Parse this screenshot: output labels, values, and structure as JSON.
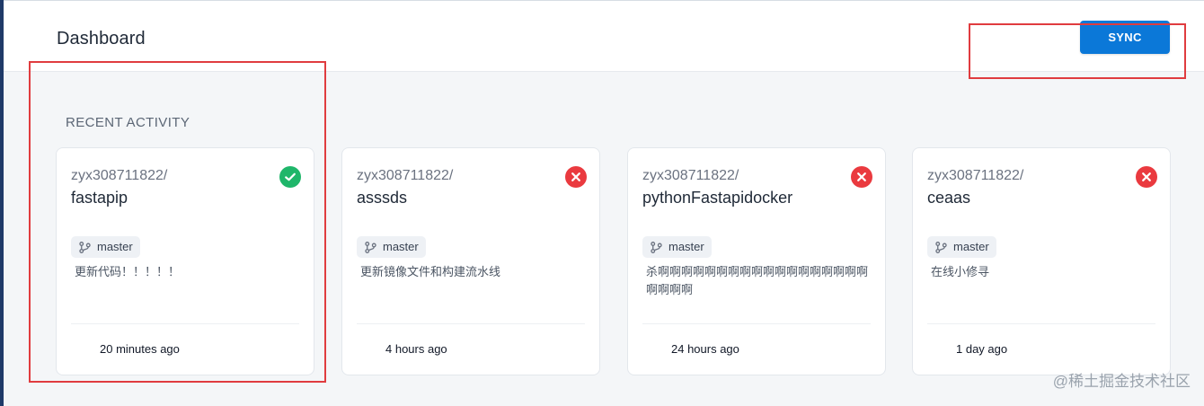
{
  "header": {
    "title": "Dashboard",
    "sync_label": "SYNC"
  },
  "section": {
    "title": "RECENT ACTIVITY"
  },
  "cards": [
    {
      "owner": "zyx308711822/",
      "repo": "fastapip",
      "status": "success",
      "status_icon": "check-circle-icon",
      "branch": "master",
      "message": "更新代码！！！！！",
      "time": "20 minutes ago"
    },
    {
      "owner": "zyx308711822/",
      "repo": "asssds",
      "status": "failure",
      "status_icon": "x-circle-icon",
      "branch": "master",
      "message": "更新镜像文件和构建流水线",
      "time": "4 hours ago"
    },
    {
      "owner": "zyx308711822/",
      "repo": "pythonFastapidocker",
      "status": "failure",
      "status_icon": "x-circle-icon",
      "branch": "master",
      "message": "杀啊啊啊啊啊啊啊啊啊啊啊啊啊啊啊啊啊啊啊啊啊啊",
      "time": "24 hours ago"
    },
    {
      "owner": "zyx308711822/",
      "repo": "ceaas",
      "status": "failure",
      "status_icon": "x-circle-icon",
      "branch": "master",
      "message": "在线小修寻",
      "time": "1 day ago"
    }
  ],
  "watermark": "@稀土掘金技术社区",
  "colors": {
    "primary": "#0b78d8",
    "success": "#1fb66a",
    "failure": "#ea3a3f",
    "highlight": "#e03c3f"
  }
}
